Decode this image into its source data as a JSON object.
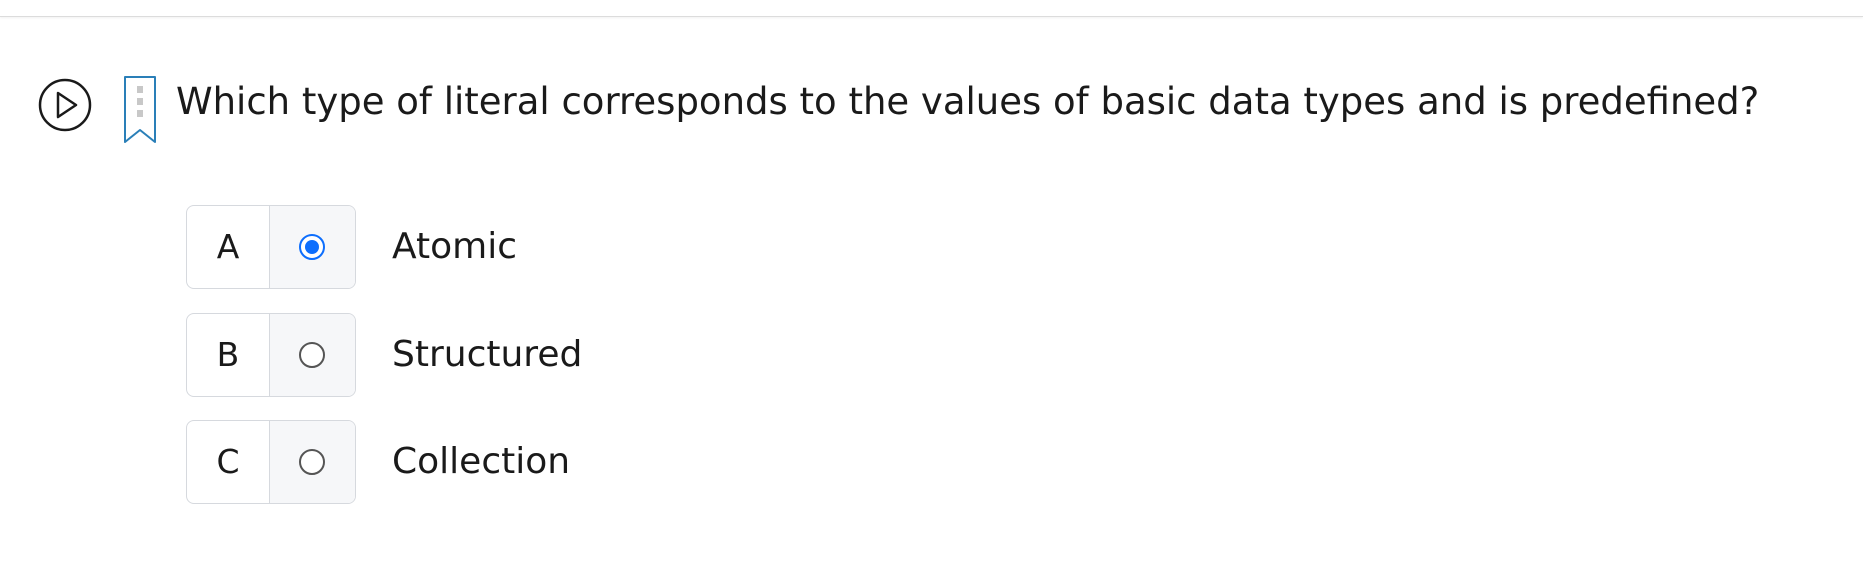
{
  "question": {
    "text": "Which type of literal corresponds to the values of basic data types and is predefined?"
  },
  "icons": {
    "play": "play-circle-icon",
    "bookmark": "bookmark-icon"
  },
  "colors": {
    "accent": "#0d6efd",
    "bookmark": "#2a7fb8",
    "border": "#d6d9de"
  },
  "options": [
    {
      "letter": "A",
      "text": "Atomic",
      "selected": true
    },
    {
      "letter": "B",
      "text": "Structured",
      "selected": false
    },
    {
      "letter": "C",
      "text": "Collection",
      "selected": false
    }
  ]
}
